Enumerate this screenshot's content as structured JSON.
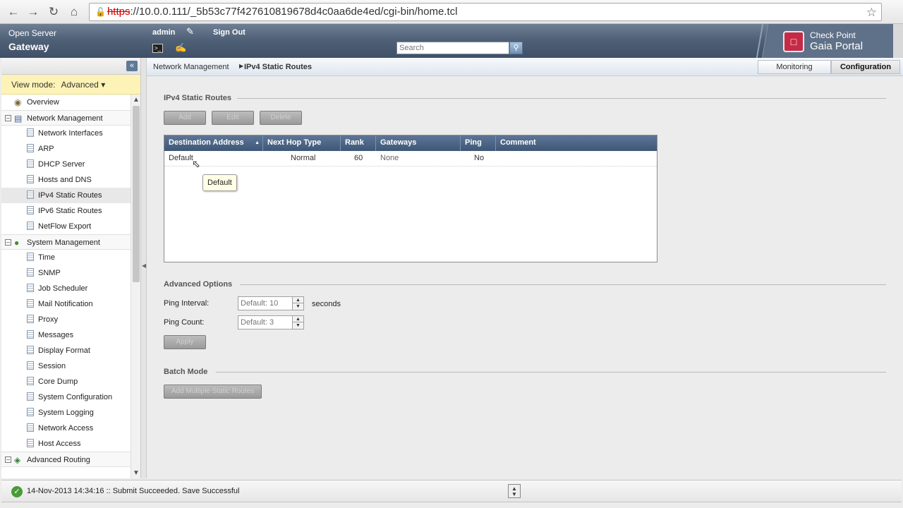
{
  "browser": {
    "url_scheme": "https",
    "url_rest": "://10.0.0.111/_5b53c77f427610819678d4c0aa6de4ed/cgi-bin/home.tcl"
  },
  "header": {
    "product_line1": "Open Server",
    "product_line2": "Gateway",
    "username": "admin",
    "signout_label": "Sign Out",
    "search_placeholder": "Search",
    "logo_line1": "Check Point",
    "logo_line2": "Gaia Portal"
  },
  "sidebar": {
    "view_mode_label": "View mode:",
    "view_mode_value": "Advanced ▾",
    "overview": "Overview",
    "network_management": {
      "label": "Network Management",
      "items": [
        "Network Interfaces",
        "ARP",
        "DHCP Server",
        "Hosts and DNS",
        "IPv4 Static Routes",
        "IPv6 Static Routes",
        "NetFlow Export"
      ]
    },
    "system_management": {
      "label": "System Management",
      "items": [
        "Time",
        "SNMP",
        "Job Scheduler",
        "Mail Notification",
        "Proxy",
        "Messages",
        "Display Format",
        "Session",
        "Core Dump",
        "System Configuration",
        "System Logging",
        "Network Access",
        "Host Access"
      ]
    },
    "advanced_routing": "Advanced Routing"
  },
  "breadcrumb": {
    "parent": "Network Management",
    "current": "IPv4 Static Routes"
  },
  "tabs": {
    "monitoring": "Monitoring",
    "configuration": "Configuration"
  },
  "static_routes": {
    "title": "IPv4 Static Routes",
    "add_label": "Add",
    "edit_label": "Edit",
    "delete_label": "Delete",
    "columns": [
      "Destination Address",
      "Next Hop Type",
      "Rank",
      "Gateways",
      "Ping",
      "Comment"
    ],
    "rows": [
      {
        "destination": "Default",
        "next_hop_type": "Normal",
        "rank": "60",
        "gateways": "None",
        "ping": "No",
        "comment": ""
      }
    ],
    "tooltip": "Default"
  },
  "advanced_options": {
    "title": "Advanced Options",
    "ping_interval_label": "Ping Interval:",
    "ping_interval_placeholder": "Default: 10",
    "seconds_label": "seconds",
    "ping_count_label": "Ping Count:",
    "ping_count_placeholder": "Default: 3",
    "apply_label": "Apply"
  },
  "batch_mode": {
    "title": "Batch Mode",
    "button_label": "Add Multiple Static Routes"
  },
  "status": {
    "message": "14-Nov-2013 14:34:16 :: Submit Succeeded. Save Successful"
  },
  "colors": {
    "header": "#4e5f75",
    "grid_header": "#4f6787",
    "view_mode_bg": "#fdf3b6",
    "status_ok": "#4a9a3a"
  }
}
